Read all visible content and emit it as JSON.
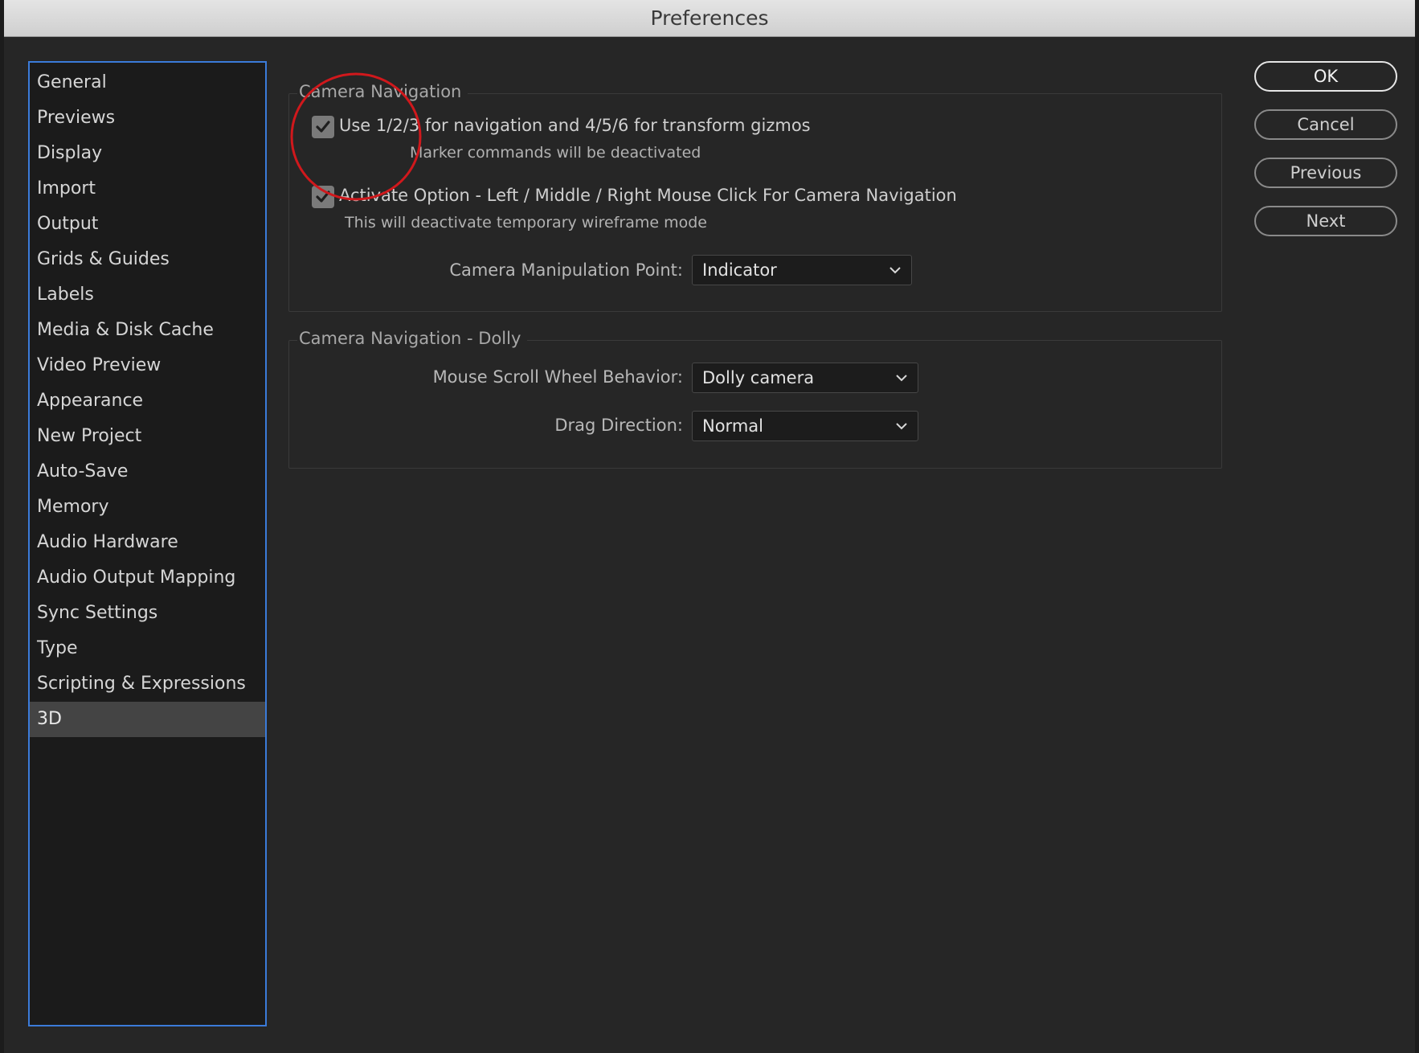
{
  "window": {
    "title": "Preferences"
  },
  "sidebar": {
    "items": [
      {
        "label": "General"
      },
      {
        "label": "Previews"
      },
      {
        "label": "Display"
      },
      {
        "label": "Import"
      },
      {
        "label": "Output"
      },
      {
        "label": "Grids & Guides"
      },
      {
        "label": "Labels"
      },
      {
        "label": "Media & Disk Cache"
      },
      {
        "label": "Video Preview"
      },
      {
        "label": "Appearance"
      },
      {
        "label": "New Project"
      },
      {
        "label": "Auto-Save"
      },
      {
        "label": "Memory"
      },
      {
        "label": "Audio Hardware"
      },
      {
        "label": "Audio Output Mapping"
      },
      {
        "label": "Sync Settings"
      },
      {
        "label": "Type"
      },
      {
        "label": "Scripting & Expressions"
      },
      {
        "label": "3D"
      }
    ],
    "selected": "3D"
  },
  "camera_navigation": {
    "legend": "Camera Navigation",
    "option1": {
      "label": "Use 1/2/3 for navigation and 4/5/6 for transform gizmos",
      "note": "Marker commands will be deactivated",
      "checked": true
    },
    "option2": {
      "label": "Activate Option - Left / Middle / Right Mouse Click For Camera Navigation",
      "note": "This will deactivate temporary wireframe mode",
      "checked": true
    },
    "manipulation_point": {
      "label": "Camera Manipulation Point:",
      "value": "Indicator"
    }
  },
  "dolly": {
    "legend": "Camera Navigation - Dolly",
    "scroll_wheel": {
      "label": "Mouse Scroll Wheel Behavior:",
      "value": "Dolly camera"
    },
    "drag_direction": {
      "label": "Drag Direction:",
      "value": "Normal"
    }
  },
  "buttons": {
    "ok": "OK",
    "cancel": "Cancel",
    "previous": "Previous",
    "next": "Next"
  },
  "colors": {
    "accent": "#3b7bd9",
    "annotation": "#d0181c",
    "background": "#262626",
    "selected": "#444444"
  },
  "icons": {
    "checkbox": "checkmark-icon",
    "dropdown": "chevron-down-icon",
    "annotation": "red-circle-highlight"
  }
}
